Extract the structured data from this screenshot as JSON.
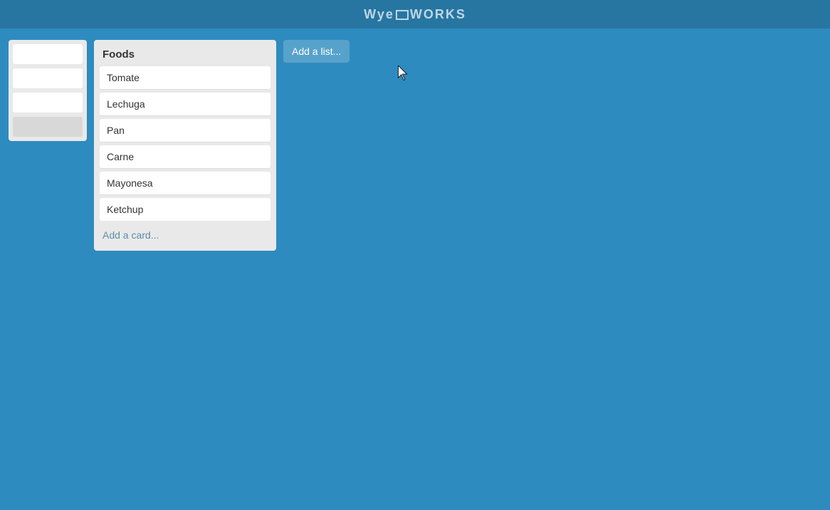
{
  "app": {
    "logo_text": "Wye",
    "logo_suffix": "WORKS"
  },
  "board": {
    "add_list_label": "Add a list..."
  },
  "foods_list": {
    "title": "Foods",
    "cards": [
      {
        "id": 1,
        "label": "Tomate"
      },
      {
        "id": 2,
        "label": "Lechuga"
      },
      {
        "id": 3,
        "label": "Pan"
      },
      {
        "id": 4,
        "label": "Carne"
      },
      {
        "id": 5,
        "label": "Mayonesa"
      },
      {
        "id": 6,
        "label": "Ketchup"
      }
    ],
    "add_card_label": "Add a card..."
  }
}
